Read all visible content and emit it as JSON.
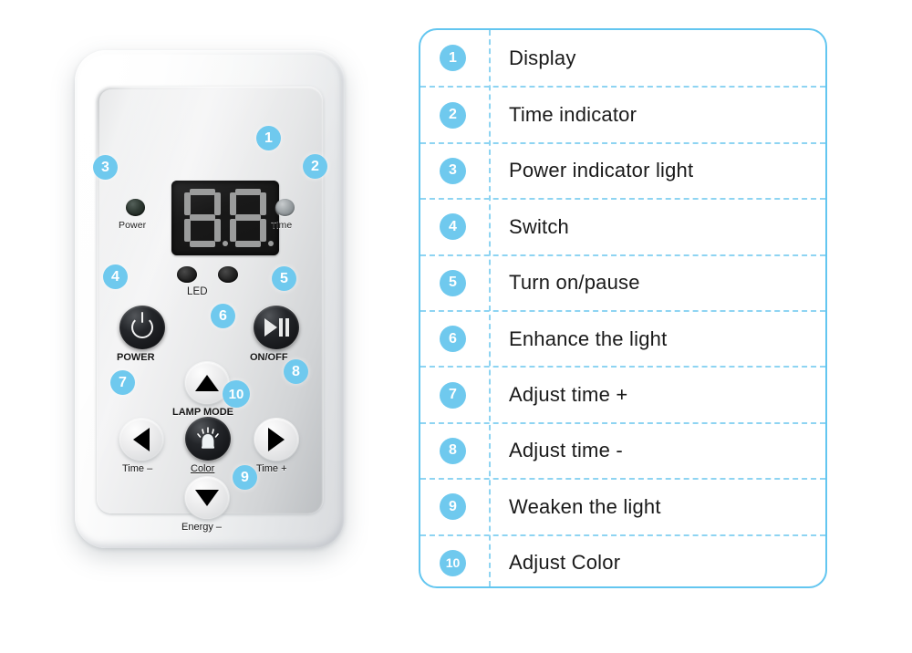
{
  "theme": {
    "accent": "#6fc9ee",
    "border": "#63c6f0",
    "dashed": "#8ed4f2",
    "background": "#ffffff",
    "text": "#1a1a1a"
  },
  "device": {
    "name": "LED light therapy controller panel",
    "display": {
      "digit_left": "8",
      "digit_right": "8",
      "decimal_points": 2
    },
    "indicators": [
      {
        "id": "power",
        "label": "Power",
        "color": "#2f3a33"
      },
      {
        "id": "time",
        "label": "Time",
        "color": "#9aa0a3"
      },
      {
        "id": "led",
        "label": "LED",
        "color": "#242424"
      }
    ],
    "buttons": [
      {
        "id": "power",
        "label": "POWER",
        "icon": "power-icon",
        "style": "dark"
      },
      {
        "id": "onoff",
        "label": "ON/OFF",
        "icon": "play-pause-icon",
        "style": "dark"
      },
      {
        "id": "lamp",
        "label": "LAMP MODE",
        "icon": "triangle-up-icon",
        "style": "light"
      },
      {
        "id": "timem",
        "label": "Time –",
        "icon": "triangle-left-icon",
        "style": "light"
      },
      {
        "id": "color",
        "label": "Color",
        "icon": "lamp-icon",
        "style": "dark"
      },
      {
        "id": "timep",
        "label": "Time +",
        "icon": "triangle-right-icon",
        "style": "light"
      },
      {
        "id": "energy",
        "label": "Energy –",
        "icon": "triangle-down-icon",
        "style": "light"
      }
    ],
    "callouts": [
      "1",
      "2",
      "3",
      "4",
      "5",
      "6",
      "7",
      "8",
      "9",
      "10"
    ]
  },
  "legend": {
    "rows": [
      {
        "num": "1",
        "label": "Display"
      },
      {
        "num": "2",
        "label": "Time indicator"
      },
      {
        "num": "3",
        "label": "Power indicator light"
      },
      {
        "num": "4",
        "label": "Switch"
      },
      {
        "num": "5",
        "label": "Turn on/pause"
      },
      {
        "num": "6",
        "label": "Enhance the light"
      },
      {
        "num": "7",
        "label": "Adjust time  +"
      },
      {
        "num": "8",
        "label": "Adjust time  -"
      },
      {
        "num": "9",
        "label": "Weaken the light"
      },
      {
        "num": "10",
        "label": "Adjust Color"
      }
    ]
  }
}
